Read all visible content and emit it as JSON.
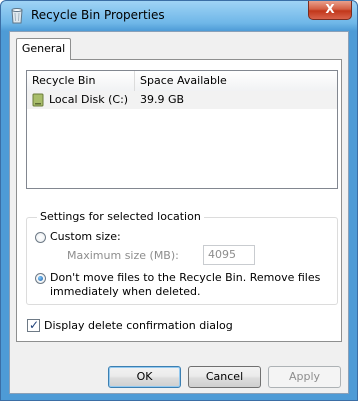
{
  "window": {
    "title": "Recycle Bin Properties",
    "close_glyph": "X"
  },
  "tabs": [
    {
      "label": "General",
      "selected": true
    }
  ],
  "list": {
    "columns": [
      "Recycle Bin Location",
      "Space Available"
    ],
    "rows": [
      {
        "location": "Local Disk (C:)",
        "space": "39.9 GB",
        "icon": "drive-icon",
        "selected": true
      }
    ]
  },
  "settings": {
    "legend": "Settings for selected location",
    "custom_size_label": "Custom size:",
    "max_size_label": "Maximum size (MB):",
    "max_size_value": "4095",
    "dont_move_label": "Don't move files to the Recycle Bin. Remove files",
    "dont_move_label_line2": "immediately when deleted.",
    "selected_option": "dont_move"
  },
  "confirm_dialog": {
    "label": "Display delete confirmation dialog",
    "checked": true
  },
  "buttons": {
    "ok": "OK",
    "cancel": "Cancel",
    "apply": "Apply"
  },
  "colors": {
    "title_bar": "#4e9bd6",
    "close_button": "#c1371b",
    "panel_bg": "#f0f0f0"
  }
}
